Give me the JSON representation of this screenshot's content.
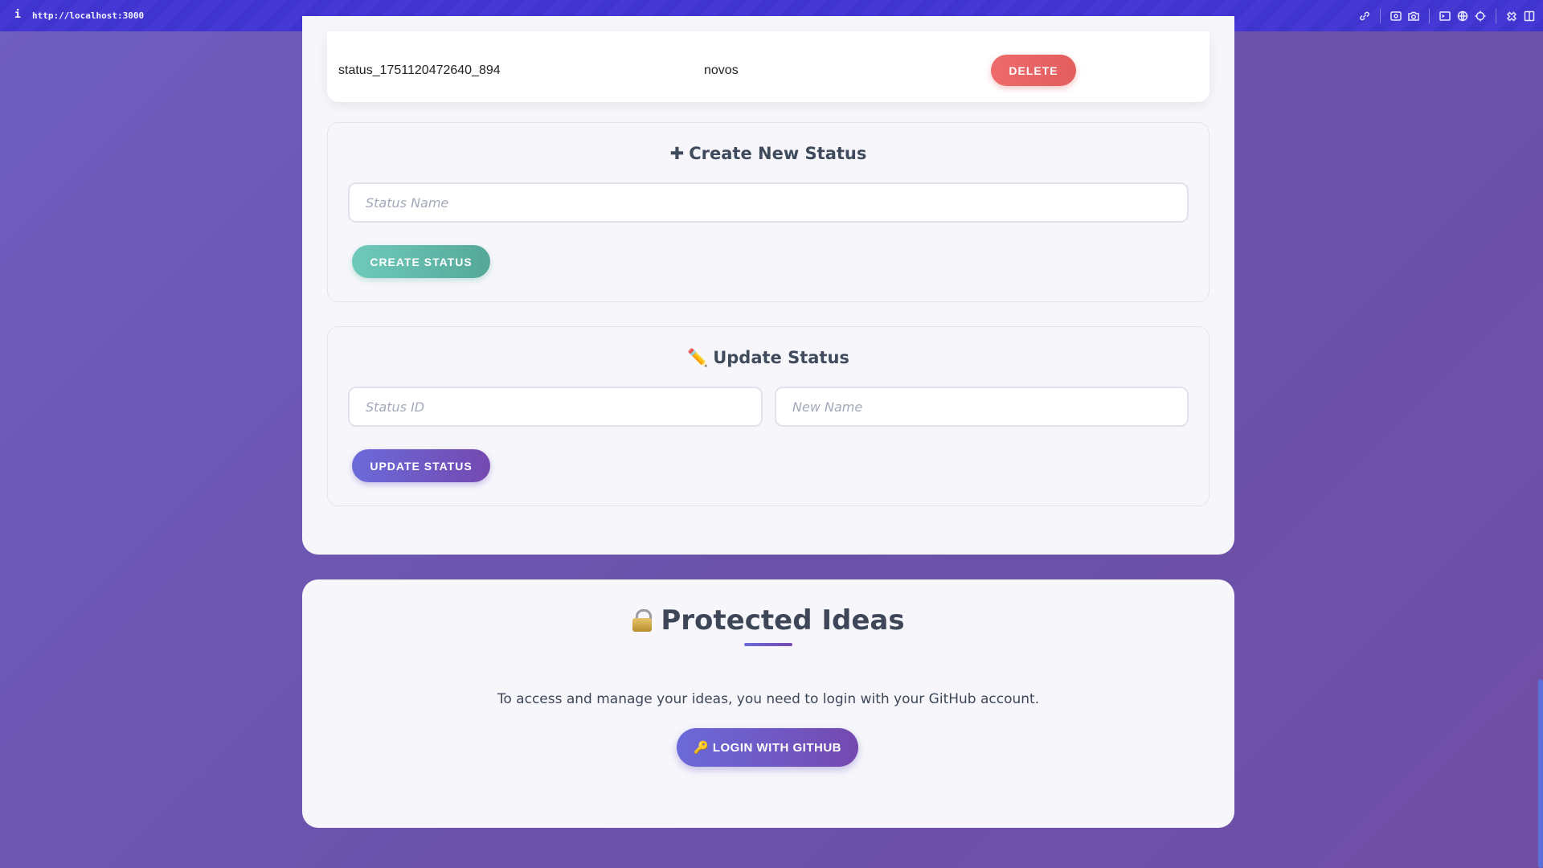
{
  "browser": {
    "info_glyph": "i",
    "url": "http://localhost:3000",
    "toolbar_icons": [
      "link-icon",
      "screenshot-icon",
      "camera-icon",
      "terminal-icon",
      "globe-icon",
      "crosshair-icon",
      "extensions-icon",
      "sidebar-icon"
    ]
  },
  "status_table": {
    "row": {
      "name": "status_1751120472640_894",
      "value": "novos",
      "delete_label": "DELETE"
    }
  },
  "create_panel": {
    "glyph": "✚",
    "title": "Create New Status",
    "name_placeholder": "Status Name",
    "button_label": "CREATE STATUS"
  },
  "update_panel": {
    "glyph": "✏️",
    "title": "Update Status",
    "id_placeholder": "Status ID",
    "new_name_placeholder": "New Name",
    "button_label": "UPDATE STATUS"
  },
  "protected": {
    "title": "Protected Ideas",
    "description": "To access and manage your ideas, you need to login with your GitHub account.",
    "login_glyph": "🔑",
    "login_label": "LOGIN WITH GITHUB"
  },
  "colors": {
    "background": "#6a52aa",
    "topbar": "#4034cf",
    "delete": "#e35d5d",
    "create": "#5fb5a6",
    "update": "#6b5cc8"
  }
}
